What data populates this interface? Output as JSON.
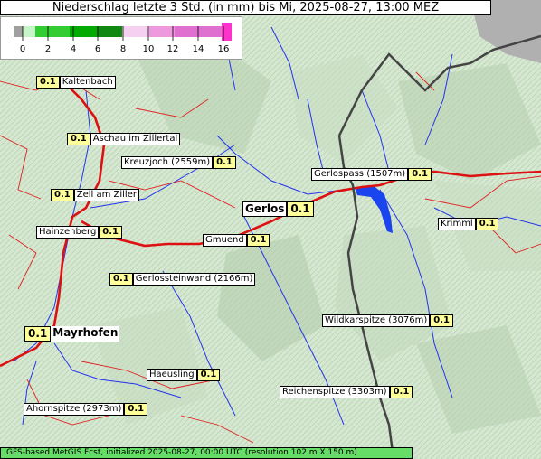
{
  "title": "Niederschlag letzte 3 Std. (in mm) bis Mi, 2025-08-27, 13:00 MEZ",
  "legend": {
    "ticks": [
      "0",
      "2",
      "4",
      "6",
      "8",
      "10",
      "12",
      "14",
      "16"
    ],
    "colors": {
      "below": "#a0a0a0",
      "g1": "#c8f5c8",
      "g2": "#33cc33",
      "g3": "#00aa00",
      "g4": "#118811",
      "p1": "#f5d0f0",
      "p2": "#ee99dd",
      "p3": "#e070d0",
      "above": "#ff33cc"
    }
  },
  "places": [
    {
      "name": "Kaltenbach",
      "value": "0.1"
    },
    {
      "name": "Aschau im Zillertal",
      "value": "0.1"
    },
    {
      "name": "Kreuzjoch (2559m)",
      "value": "0.1"
    },
    {
      "name": "Gerlospass (1507m)",
      "value": "0.1"
    },
    {
      "name": "Zell am Ziller",
      "value": "0.1"
    },
    {
      "name": "Gerlos",
      "value": "0.1"
    },
    {
      "name": "Krimml",
      "value": "0.1"
    },
    {
      "name": "Hainzenberg",
      "value": "0.1"
    },
    {
      "name": "Gmuend",
      "value": "0.1"
    },
    {
      "name": "Gerlossteinwand (2166m)",
      "value": "0.1"
    },
    {
      "name": "Wildkarspitze (3076m)",
      "value": "0.1"
    },
    {
      "name": "Mayrhofen",
      "value": "0.1"
    },
    {
      "name": "Haeusling",
      "value": "0.1"
    },
    {
      "name": "Reichenspitze (3303m)",
      "value": "0.1"
    },
    {
      "name": "Ahornspitze (2973m)",
      "value": "0.1"
    }
  ],
  "footer": "GFS-based MetGIS Fcst, initialized 2025-08-27, 00:00 UTC (resolution 102 m X 150 m)"
}
